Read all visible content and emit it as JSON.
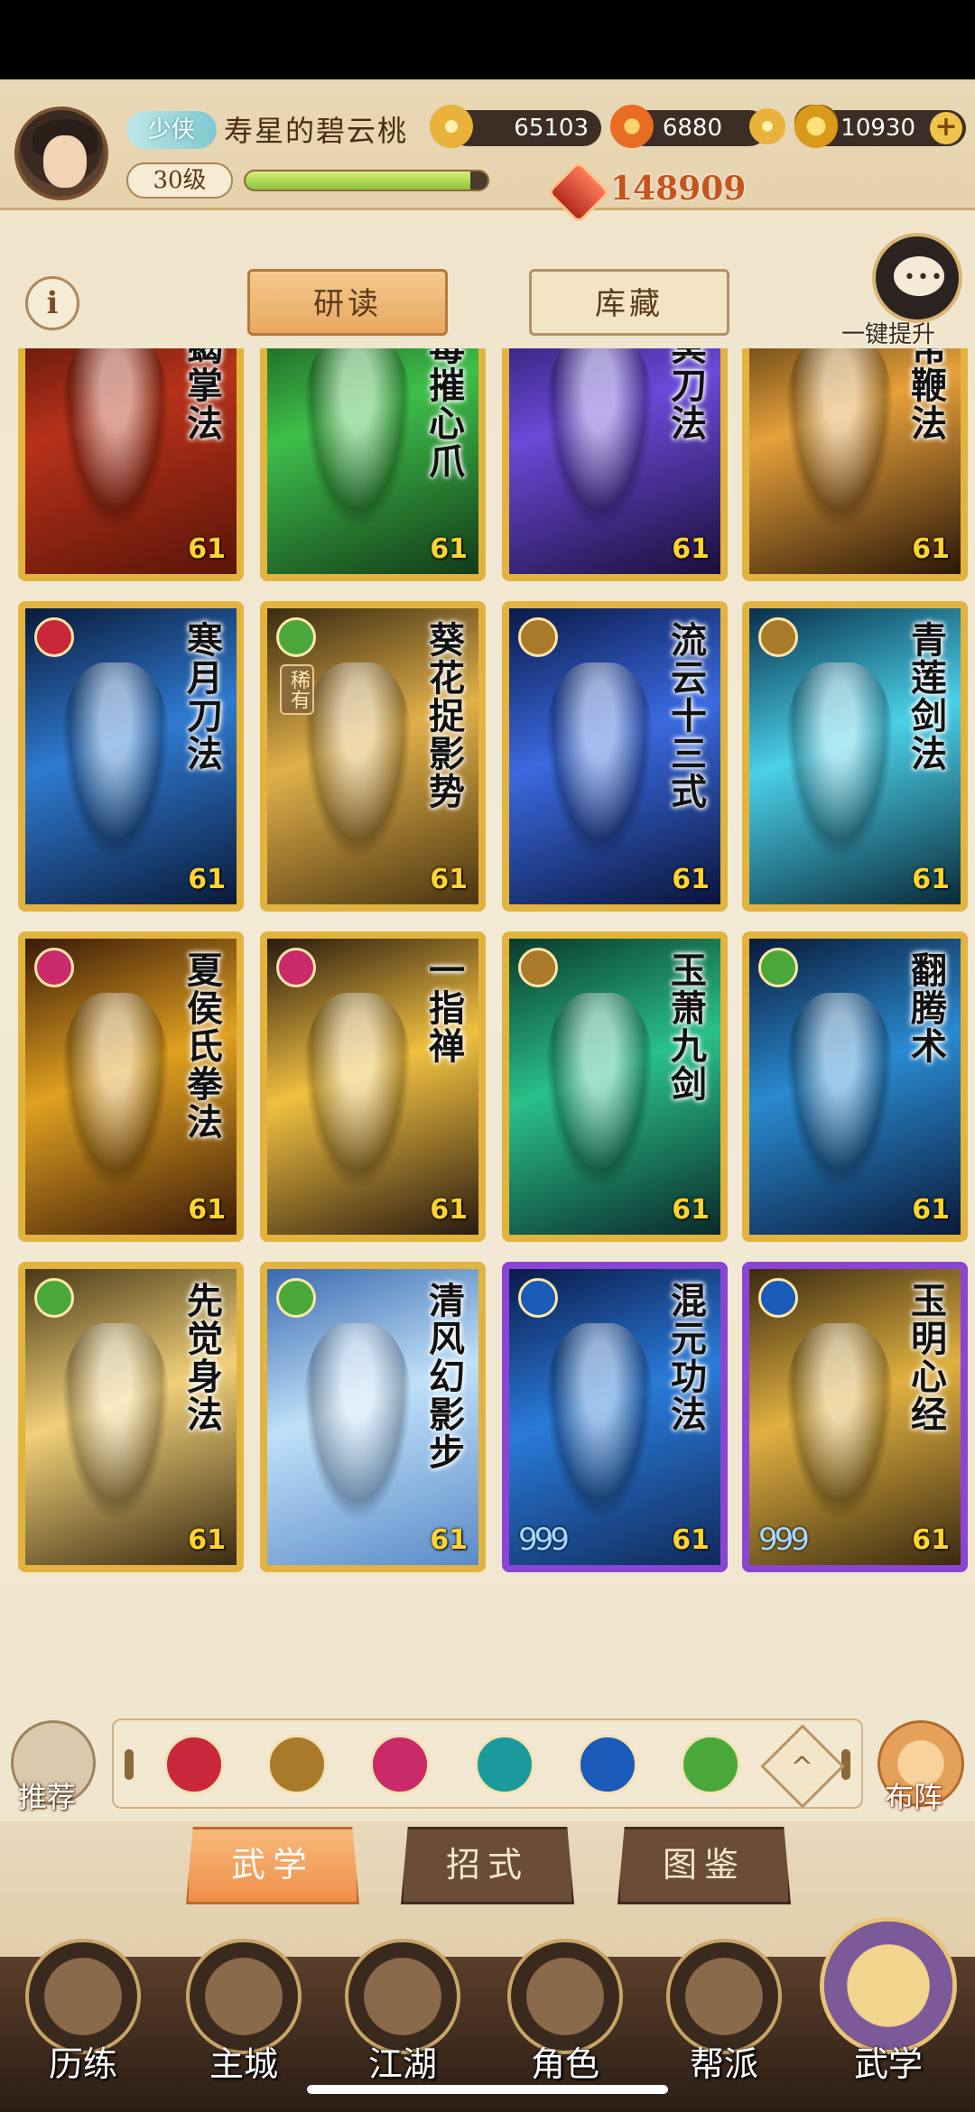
{
  "player": {
    "rank": "少侠",
    "name": "寿星的碧云桃",
    "level": "30级",
    "xp_fraction": 0.93,
    "power": "148909"
  },
  "resources": {
    "coins": "65103",
    "embers": "6880",
    "ingots": "10930"
  },
  "subtabs": [
    "研读",
    "库藏"
  ],
  "chat_label": "一键提升",
  "cards": [
    {
      "title": "赤蝎掌法",
      "level": "61",
      "frame": "gold",
      "type_color": "#c9283a",
      "bg": "linear-gradient(160deg,#3a0d06,#b8321a 45%,#5a1408)"
    },
    {
      "title": "五毒摧心爪",
      "level": "61",
      "frame": "gold",
      "type_color": "#c9283a",
      "bg": "linear-gradient(160deg,#0f3a12,#3fbf4a 45%,#123a18)"
    },
    {
      "title": "绝冥刀法",
      "level": "61",
      "frame": "gold",
      "type_color": "#c9283a",
      "bg": "linear-gradient(160deg,#1a0f4a,#6a4ad8 45%,#1a0f3a)"
    },
    {
      "title": "无常鞭法",
      "level": "61",
      "frame": "gold",
      "type_color": "#1a9a9a",
      "bg": "linear-gradient(160deg,#2a1a08,#e6a03a 45%,#2a1608)"
    },
    {
      "title": "寒月刀法",
      "level": "61",
      "frame": "gold",
      "type_color": "#c9283a",
      "bg": "linear-gradient(160deg,#0a1a3a,#2f7ad0 45%,#0a1a3a)"
    },
    {
      "title": "葵花捉影势",
      "level": "61",
      "frame": "gold",
      "type_color": "#4aa83a",
      "bg": "linear-gradient(160deg,#3a2a10,#e0b04a 45%,#4a3410)",
      "rare": "稀有"
    },
    {
      "title": "流云十三式",
      "level": "61",
      "frame": "gold",
      "type_color": "#a87a2a",
      "bg": "linear-gradient(160deg,#0a1a4a,#3a6ae0 45%,#0a143a)"
    },
    {
      "title": "青莲剑法",
      "level": "61",
      "frame": "gold",
      "type_color": "#a87a2a",
      "bg": "linear-gradient(160deg,#08304a,#4ad0e8 45%,#0a2a3a)"
    },
    {
      "title": "夏侯氏拳法",
      "level": "61",
      "frame": "gold",
      "type_color": "#c92a6a",
      "bg": "linear-gradient(160deg,#3a1a08,#e0a020 45%,#3a1a08)"
    },
    {
      "title": "一指禅",
      "level": "61",
      "frame": "gold",
      "type_color": "#c92a6a",
      "bg": "linear-gradient(160deg,#2a1a10,#f0c040 45%,#2a1a10)"
    },
    {
      "title": "玉萧九剑",
      "level": "61",
      "frame": "gold",
      "type_color": "#a87a2a",
      "bg": "linear-gradient(160deg,#0a3a2a,#2ac08a 45%,#0a2a2a)"
    },
    {
      "title": "翻腾术",
      "level": "61",
      "frame": "gold",
      "type_color": "#4aa83a",
      "bg": "linear-gradient(160deg,#0a1a3a,#2a8ad0 45%,#0a1a3a)"
    },
    {
      "title": "先觉身法",
      "level": "61",
      "frame": "gold",
      "type_color": "#4aa83a",
      "bg": "linear-gradient(160deg,#4a3a18,#f0d07a 45%,#3a2a10)"
    },
    {
      "title": "清风幻影步",
      "level": "61",
      "frame": "gold",
      "type_color": "#4aa83a",
      "bg": "linear-gradient(160deg,#3a6ab0,#bfe0f8 45%,#5a8ac8)"
    },
    {
      "title": "混元功法",
      "level": "61",
      "frame": "purple",
      "type_color": "#1a5ab8",
      "bg": "linear-gradient(160deg,#0a1a4a,#2a7ad8 45%,#102a5a)",
      "stars": "999"
    },
    {
      "title": "玉明心经",
      "level": "61",
      "frame": "purple",
      "type_color": "#1a5ab8",
      "bg": "linear-gradient(160deg,#3a2a10,#e0b040 45%,#3a2a10)",
      "stars": "999"
    }
  ],
  "filters": [
    {
      "name": "fist",
      "color": "#c9283a"
    },
    {
      "name": "sword",
      "color": "#a87a2a"
    },
    {
      "name": "palm",
      "color": "#c92a6a"
    },
    {
      "name": "fan",
      "color": "#1a9a9a"
    },
    {
      "name": "internal",
      "color": "#1a5ab8"
    },
    {
      "name": "movement",
      "color": "#4aa83a"
    }
  ],
  "recommend_label": "推荐",
  "formation_label": "布阵",
  "section_tabs": [
    "武学",
    "招式",
    "图鉴"
  ],
  "nav": [
    "历练",
    "主城",
    "江湖",
    "角色",
    "帮派",
    "武学"
  ]
}
